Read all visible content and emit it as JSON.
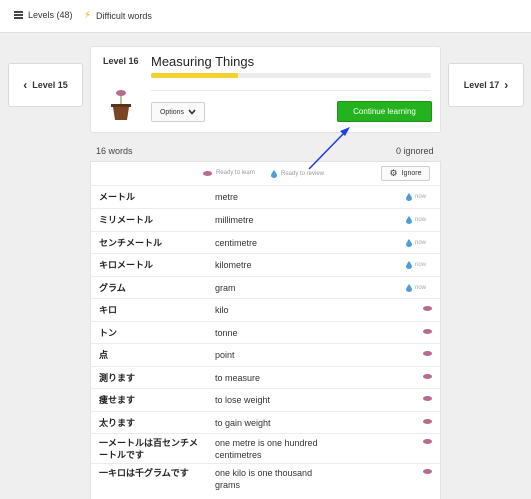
{
  "topbar": {
    "levels_label": "Levels (48)",
    "difficult_label": "Difficult words"
  },
  "nav": {
    "prev_label": "Level 15",
    "next_label": "Level 17"
  },
  "level": {
    "number_label": "Level 16",
    "title": "Measuring Things",
    "progress_fraction": 0.31,
    "options_label": "Options",
    "continue_label": "Continue learning"
  },
  "summary": {
    "words_count": "16 words",
    "ignored_count": "0 ignored"
  },
  "legend": {
    "ready_to_learn": "Ready to learn",
    "ready_to_review": "Ready to review",
    "ignore_label": "Ignore"
  },
  "colors": {
    "continue": "#24b31e",
    "progress": "#f2d131",
    "seed": "#b76b8f",
    "drop": "#4a9fd4"
  },
  "words": [
    {
      "jp": "メートル",
      "en": "metre",
      "status": "review",
      "time": "now"
    },
    {
      "jp": "ミリメートル",
      "en": "millimetre",
      "status": "review",
      "time": "now"
    },
    {
      "jp": "センチメートル",
      "en": "centimetre",
      "status": "review",
      "time": "now"
    },
    {
      "jp": "キロメートル",
      "en": "kilometre",
      "status": "review",
      "time": "now"
    },
    {
      "jp": "グラム",
      "en": "gram",
      "status": "review",
      "time": "now"
    },
    {
      "jp": "キロ",
      "en": "kilo",
      "status": "learn",
      "time": ""
    },
    {
      "jp": "トン",
      "en": "tonne",
      "status": "learn",
      "time": ""
    },
    {
      "jp": "点",
      "en": "point",
      "status": "learn",
      "time": ""
    },
    {
      "jp": "測ります",
      "en": "to measure",
      "status": "learn",
      "time": ""
    },
    {
      "jp": "痩せます",
      "en": "to lose weight",
      "status": "learn",
      "time": ""
    },
    {
      "jp": "太ります",
      "en": "to gain weight",
      "status": "learn",
      "time": ""
    },
    {
      "jp": "一メートルは百センチメートルです",
      "en": "one metre is one hundred centimetres",
      "status": "learn",
      "time": ""
    },
    {
      "jp": "一キロは千グラムです",
      "en": "one kilo is one thousand grams",
      "status": "learn",
      "time": ""
    }
  ]
}
